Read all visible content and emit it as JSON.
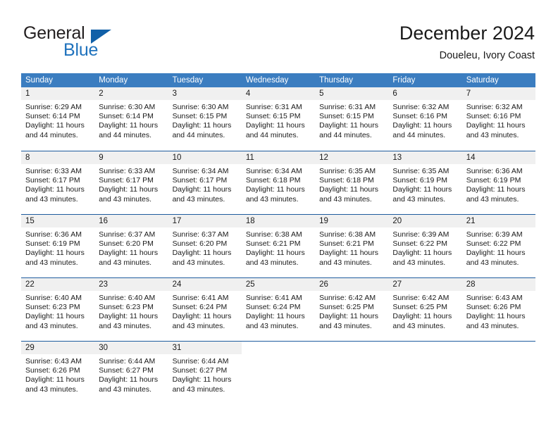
{
  "brand": {
    "name_top": "General",
    "name_bottom": "Blue",
    "logo_icon": "blue-triangle-icon",
    "colors": {
      "dark": "#231f20",
      "blue": "#1f72bd",
      "triangle": "#1160a8"
    }
  },
  "header": {
    "title": "December 2024",
    "subtitle": "Doueleu, Ivory Coast"
  },
  "calendar": {
    "header_bg": "#3b7dc0",
    "row_divider": "#1e5c9e",
    "daynum_bg": "#f0f0f0",
    "weekdays": [
      "Sunday",
      "Monday",
      "Tuesday",
      "Wednesday",
      "Thursday",
      "Friday",
      "Saturday"
    ],
    "weeks": [
      [
        {
          "day": "1",
          "lines": [
            "Sunrise: 6:29 AM",
            "Sunset: 6:14 PM",
            "Daylight: 11 hours and 44 minutes."
          ]
        },
        {
          "day": "2",
          "lines": [
            "Sunrise: 6:30 AM",
            "Sunset: 6:14 PM",
            "Daylight: 11 hours and 44 minutes."
          ]
        },
        {
          "day": "3",
          "lines": [
            "Sunrise: 6:30 AM",
            "Sunset: 6:15 PM",
            "Daylight: 11 hours and 44 minutes."
          ]
        },
        {
          "day": "4",
          "lines": [
            "Sunrise: 6:31 AM",
            "Sunset: 6:15 PM",
            "Daylight: 11 hours and 44 minutes."
          ]
        },
        {
          "day": "5",
          "lines": [
            "Sunrise: 6:31 AM",
            "Sunset: 6:15 PM",
            "Daylight: 11 hours and 44 minutes."
          ]
        },
        {
          "day": "6",
          "lines": [
            "Sunrise: 6:32 AM",
            "Sunset: 6:16 PM",
            "Daylight: 11 hours and 44 minutes."
          ]
        },
        {
          "day": "7",
          "lines": [
            "Sunrise: 6:32 AM",
            "Sunset: 6:16 PM",
            "Daylight: 11 hours and 43 minutes."
          ]
        }
      ],
      [
        {
          "day": "8",
          "lines": [
            "Sunrise: 6:33 AM",
            "Sunset: 6:17 PM",
            "Daylight: 11 hours and 43 minutes."
          ]
        },
        {
          "day": "9",
          "lines": [
            "Sunrise: 6:33 AM",
            "Sunset: 6:17 PM",
            "Daylight: 11 hours and 43 minutes."
          ]
        },
        {
          "day": "10",
          "lines": [
            "Sunrise: 6:34 AM",
            "Sunset: 6:17 PM",
            "Daylight: 11 hours and 43 minutes."
          ]
        },
        {
          "day": "11",
          "lines": [
            "Sunrise: 6:34 AM",
            "Sunset: 6:18 PM",
            "Daylight: 11 hours and 43 minutes."
          ]
        },
        {
          "day": "12",
          "lines": [
            "Sunrise: 6:35 AM",
            "Sunset: 6:18 PM",
            "Daylight: 11 hours and 43 minutes."
          ]
        },
        {
          "day": "13",
          "lines": [
            "Sunrise: 6:35 AM",
            "Sunset: 6:19 PM",
            "Daylight: 11 hours and 43 minutes."
          ]
        },
        {
          "day": "14",
          "lines": [
            "Sunrise: 6:36 AM",
            "Sunset: 6:19 PM",
            "Daylight: 11 hours and 43 minutes."
          ]
        }
      ],
      [
        {
          "day": "15",
          "lines": [
            "Sunrise: 6:36 AM",
            "Sunset: 6:19 PM",
            "Daylight: 11 hours and 43 minutes."
          ]
        },
        {
          "day": "16",
          "lines": [
            "Sunrise: 6:37 AM",
            "Sunset: 6:20 PM",
            "Daylight: 11 hours and 43 minutes."
          ]
        },
        {
          "day": "17",
          "lines": [
            "Sunrise: 6:37 AM",
            "Sunset: 6:20 PM",
            "Daylight: 11 hours and 43 minutes."
          ]
        },
        {
          "day": "18",
          "lines": [
            "Sunrise: 6:38 AM",
            "Sunset: 6:21 PM",
            "Daylight: 11 hours and 43 minutes."
          ]
        },
        {
          "day": "19",
          "lines": [
            "Sunrise: 6:38 AM",
            "Sunset: 6:21 PM",
            "Daylight: 11 hours and 43 minutes."
          ]
        },
        {
          "day": "20",
          "lines": [
            "Sunrise: 6:39 AM",
            "Sunset: 6:22 PM",
            "Daylight: 11 hours and 43 minutes."
          ]
        },
        {
          "day": "21",
          "lines": [
            "Sunrise: 6:39 AM",
            "Sunset: 6:22 PM",
            "Daylight: 11 hours and 43 minutes."
          ]
        }
      ],
      [
        {
          "day": "22",
          "lines": [
            "Sunrise: 6:40 AM",
            "Sunset: 6:23 PM",
            "Daylight: 11 hours and 43 minutes."
          ]
        },
        {
          "day": "23",
          "lines": [
            "Sunrise: 6:40 AM",
            "Sunset: 6:23 PM",
            "Daylight: 11 hours and 43 minutes."
          ]
        },
        {
          "day": "24",
          "lines": [
            "Sunrise: 6:41 AM",
            "Sunset: 6:24 PM",
            "Daylight: 11 hours and 43 minutes."
          ]
        },
        {
          "day": "25",
          "lines": [
            "Sunrise: 6:41 AM",
            "Sunset: 6:24 PM",
            "Daylight: 11 hours and 43 minutes."
          ]
        },
        {
          "day": "26",
          "lines": [
            "Sunrise: 6:42 AM",
            "Sunset: 6:25 PM",
            "Daylight: 11 hours and 43 minutes."
          ]
        },
        {
          "day": "27",
          "lines": [
            "Sunrise: 6:42 AM",
            "Sunset: 6:25 PM",
            "Daylight: 11 hours and 43 minutes."
          ]
        },
        {
          "day": "28",
          "lines": [
            "Sunrise: 6:43 AM",
            "Sunset: 6:26 PM",
            "Daylight: 11 hours and 43 minutes."
          ]
        }
      ],
      [
        {
          "day": "29",
          "lines": [
            "Sunrise: 6:43 AM",
            "Sunset: 6:26 PM",
            "Daylight: 11 hours and 43 minutes."
          ]
        },
        {
          "day": "30",
          "lines": [
            "Sunrise: 6:44 AM",
            "Sunset: 6:27 PM",
            "Daylight: 11 hours and 43 minutes."
          ]
        },
        {
          "day": "31",
          "lines": [
            "Sunrise: 6:44 AM",
            "Sunset: 6:27 PM",
            "Daylight: 11 hours and 43 minutes."
          ]
        },
        {
          "day": "",
          "lines": []
        },
        {
          "day": "",
          "lines": []
        },
        {
          "day": "",
          "lines": []
        },
        {
          "day": "",
          "lines": []
        }
      ]
    ]
  }
}
